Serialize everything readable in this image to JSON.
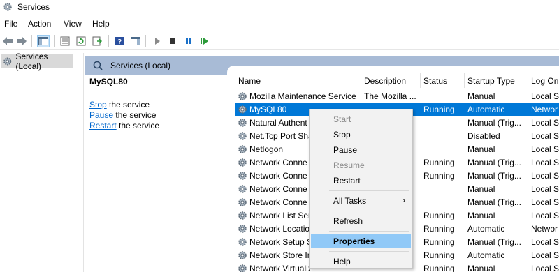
{
  "window": {
    "title": "Services",
    "app_icon": "services-gear-icon"
  },
  "menubar": [
    "File",
    "Action",
    "View",
    "Help"
  ],
  "toolbar": {
    "buttons": [
      "back-arrow-icon",
      "forward-arrow-icon",
      "show-hide-tree-icon",
      "properties-icon",
      "refresh-icon",
      "export-list-icon",
      "help-icon",
      "show-hide-action-pane-icon",
      "start-service-icon",
      "stop-service-icon",
      "pause-service-icon",
      "restart-service-icon"
    ]
  },
  "tree": {
    "root_label": "Services (Local)"
  },
  "pane": {
    "header_label": "Services (Local)",
    "selected_service": "MySQL80",
    "actions": [
      {
        "link": "Stop",
        "suffix": " the service"
      },
      {
        "link": "Pause",
        "suffix": " the service"
      },
      {
        "link": "Restart",
        "suffix": " the service"
      }
    ]
  },
  "columns": [
    "Name",
    "Description",
    "Status",
    "Startup Type",
    "Log On"
  ],
  "rows": [
    {
      "name": "Mozilla Maintenance Service",
      "description": "The Mozilla ...",
      "status": "",
      "startup": "Manual",
      "logon": "Local Sy"
    },
    {
      "name": "MySQL80",
      "description": "",
      "status": "Running",
      "startup": "Automatic",
      "logon": "Networ",
      "selected": true
    },
    {
      "name": "Natural Authent",
      "description": "",
      "status": "",
      "startup": "Manual (Trig...",
      "logon": "Local Sy"
    },
    {
      "name": "Net.Tcp Port Sha",
      "description": "",
      "status": "",
      "startup": "Disabled",
      "logon": "Local Se"
    },
    {
      "name": "Netlogon",
      "description": "",
      "status": "",
      "startup": "Manual",
      "logon": "Local Sy"
    },
    {
      "name": "Network Conne",
      "description": "",
      "status": "Running",
      "startup": "Manual (Trig...",
      "logon": "Local Sy"
    },
    {
      "name": "Network Conne",
      "description": "",
      "status": "Running",
      "startup": "Manual (Trig...",
      "logon": "Local Sy"
    },
    {
      "name": "Network Conne",
      "description": "",
      "status": "",
      "startup": "Manual",
      "logon": "Local Sy"
    },
    {
      "name": "Network Conne",
      "description": "",
      "status": "",
      "startup": "Manual (Trig...",
      "logon": "Local Sy"
    },
    {
      "name": "Network List Ser",
      "description": "",
      "status": "Running",
      "startup": "Manual",
      "logon": "Local Se"
    },
    {
      "name": "Network Locatio",
      "description": "",
      "status": "Running",
      "startup": "Automatic",
      "logon": "Networ"
    },
    {
      "name": "Network Setup S",
      "description": "",
      "status": "Running",
      "startup": "Manual (Trig...",
      "logon": "Local Sy"
    },
    {
      "name": "Network Store In",
      "description": "",
      "status": "Running",
      "startup": "Automatic",
      "logon": "Local Se"
    },
    {
      "name": "Network Virtualiz",
      "description": "",
      "status": "Running",
      "startup": "Manual",
      "logon": "Local Sy"
    }
  ],
  "context_menu": {
    "items": [
      {
        "label": "Start",
        "disabled": true
      },
      {
        "label": "Stop"
      },
      {
        "label": "Pause"
      },
      {
        "label": "Resume",
        "disabled": true
      },
      {
        "label": "Restart"
      },
      {
        "label": "All Tasks",
        "submenu": true
      },
      {
        "label": "Refresh"
      },
      {
        "label": "Properties",
        "highlighted": true
      },
      {
        "label": "Help"
      }
    ]
  },
  "colors": {
    "selection": "#0078d7",
    "menu_highlight": "#91c9f7",
    "header_band": "#a8bbd6",
    "link": "#0066cc"
  }
}
